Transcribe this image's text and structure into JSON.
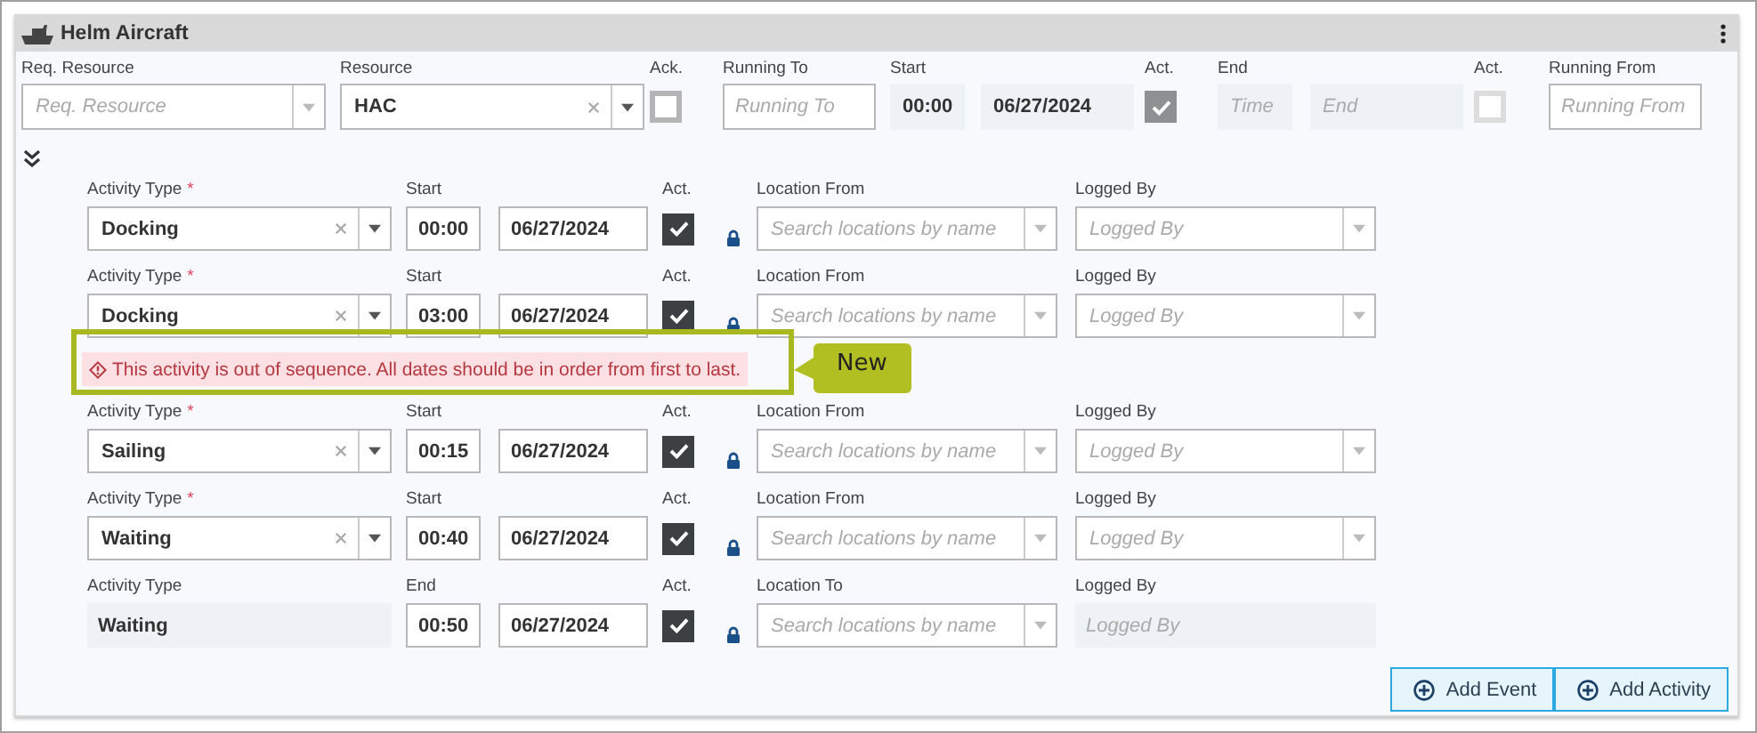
{
  "panel": {
    "title": "Helm Aircraft"
  },
  "resource_row": [
    {
      "kind": "select",
      "label": "Req. Resource",
      "placeholder": "Req. Resource"
    },
    {
      "kind": "select",
      "label": "Resource",
      "value": "HAC"
    },
    {
      "kind": "checkbox",
      "label": "Ack.",
      "checked": false,
      "disabled": false
    },
    {
      "kind": "text",
      "label": "Running To",
      "placeholder": "Running To",
      "disabled": false
    },
    {
      "kind": "time",
      "label": "Start",
      "value": "00:00",
      "disabled": true
    },
    {
      "kind": "date",
      "value": "06/27/2024",
      "disabled": true
    },
    {
      "kind": "checkbox",
      "label": "Act.",
      "checked": true,
      "disabled": true
    },
    {
      "kind": "time",
      "label": "End",
      "placeholder": "Time",
      "disabled": true
    },
    {
      "kind": "date",
      "placeholder": "End",
      "disabled": true
    },
    {
      "kind": "checkbox",
      "label": "Act.",
      "checked": false,
      "disabled": true
    },
    {
      "kind": "text",
      "label": "Running From",
      "placeholder": "Running From",
      "disabled": false
    }
  ],
  "activities": [
    {
      "type_label": "Activity Type",
      "required_mark": "*",
      "type_editable": true,
      "activity_type": "Docking",
      "time_label": "Start",
      "time": "00:00",
      "date": "06/27/2024",
      "act_label": "Act.",
      "act_checked": true,
      "location_label": "Location From",
      "location_placeholder": "Search locations by name",
      "logged_label": "Logged By",
      "logged_placeholder": "Logged By",
      "logged_editable": true
    },
    {
      "type_label": "Activity Type",
      "required_mark": "*",
      "type_editable": true,
      "activity_type": "Docking",
      "time_label": "Start",
      "time": "03:00",
      "date": "06/27/2024",
      "act_label": "Act.",
      "act_checked": true,
      "location_label": "Location From",
      "location_placeholder": "Search locations by name",
      "logged_label": "Logged By",
      "logged_placeholder": "Logged By",
      "logged_editable": true,
      "error": "This activity is out of sequence. All dates should be in order from first to last.",
      "callout": "New"
    },
    {
      "type_label": "Activity Type",
      "required_mark": "*",
      "type_editable": true,
      "activity_type": "Sailing",
      "time_label": "Start",
      "time": "00:15",
      "date": "06/27/2024",
      "act_label": "Act.",
      "act_checked": true,
      "location_label": "Location From",
      "location_placeholder": "Search locations by name",
      "logged_label": "Logged By",
      "logged_placeholder": "Logged By",
      "logged_editable": true
    },
    {
      "type_label": "Activity Type",
      "required_mark": "*",
      "type_editable": true,
      "activity_type": "Waiting",
      "time_label": "Start",
      "time": "00:40",
      "date": "06/27/2024",
      "act_label": "Act.",
      "act_checked": true,
      "location_label": "Location From",
      "location_placeholder": "Search locations by name",
      "logged_label": "Logged By",
      "logged_placeholder": "Logged By",
      "logged_editable": true
    },
    {
      "type_label": "Activity Type",
      "type_editable": false,
      "activity_type": "Waiting",
      "time_label": "End",
      "time": "00:50",
      "date": "06/27/2024",
      "act_label": "Act.",
      "act_checked": true,
      "location_label": "Location To",
      "location_placeholder": "Search locations by name",
      "logged_label": "Logged By",
      "logged_placeholder": "Logged By",
      "logged_editable": false
    }
  ],
  "buttons": [
    {
      "label": "Add Event"
    },
    {
      "label": "Add Activity"
    }
  ]
}
